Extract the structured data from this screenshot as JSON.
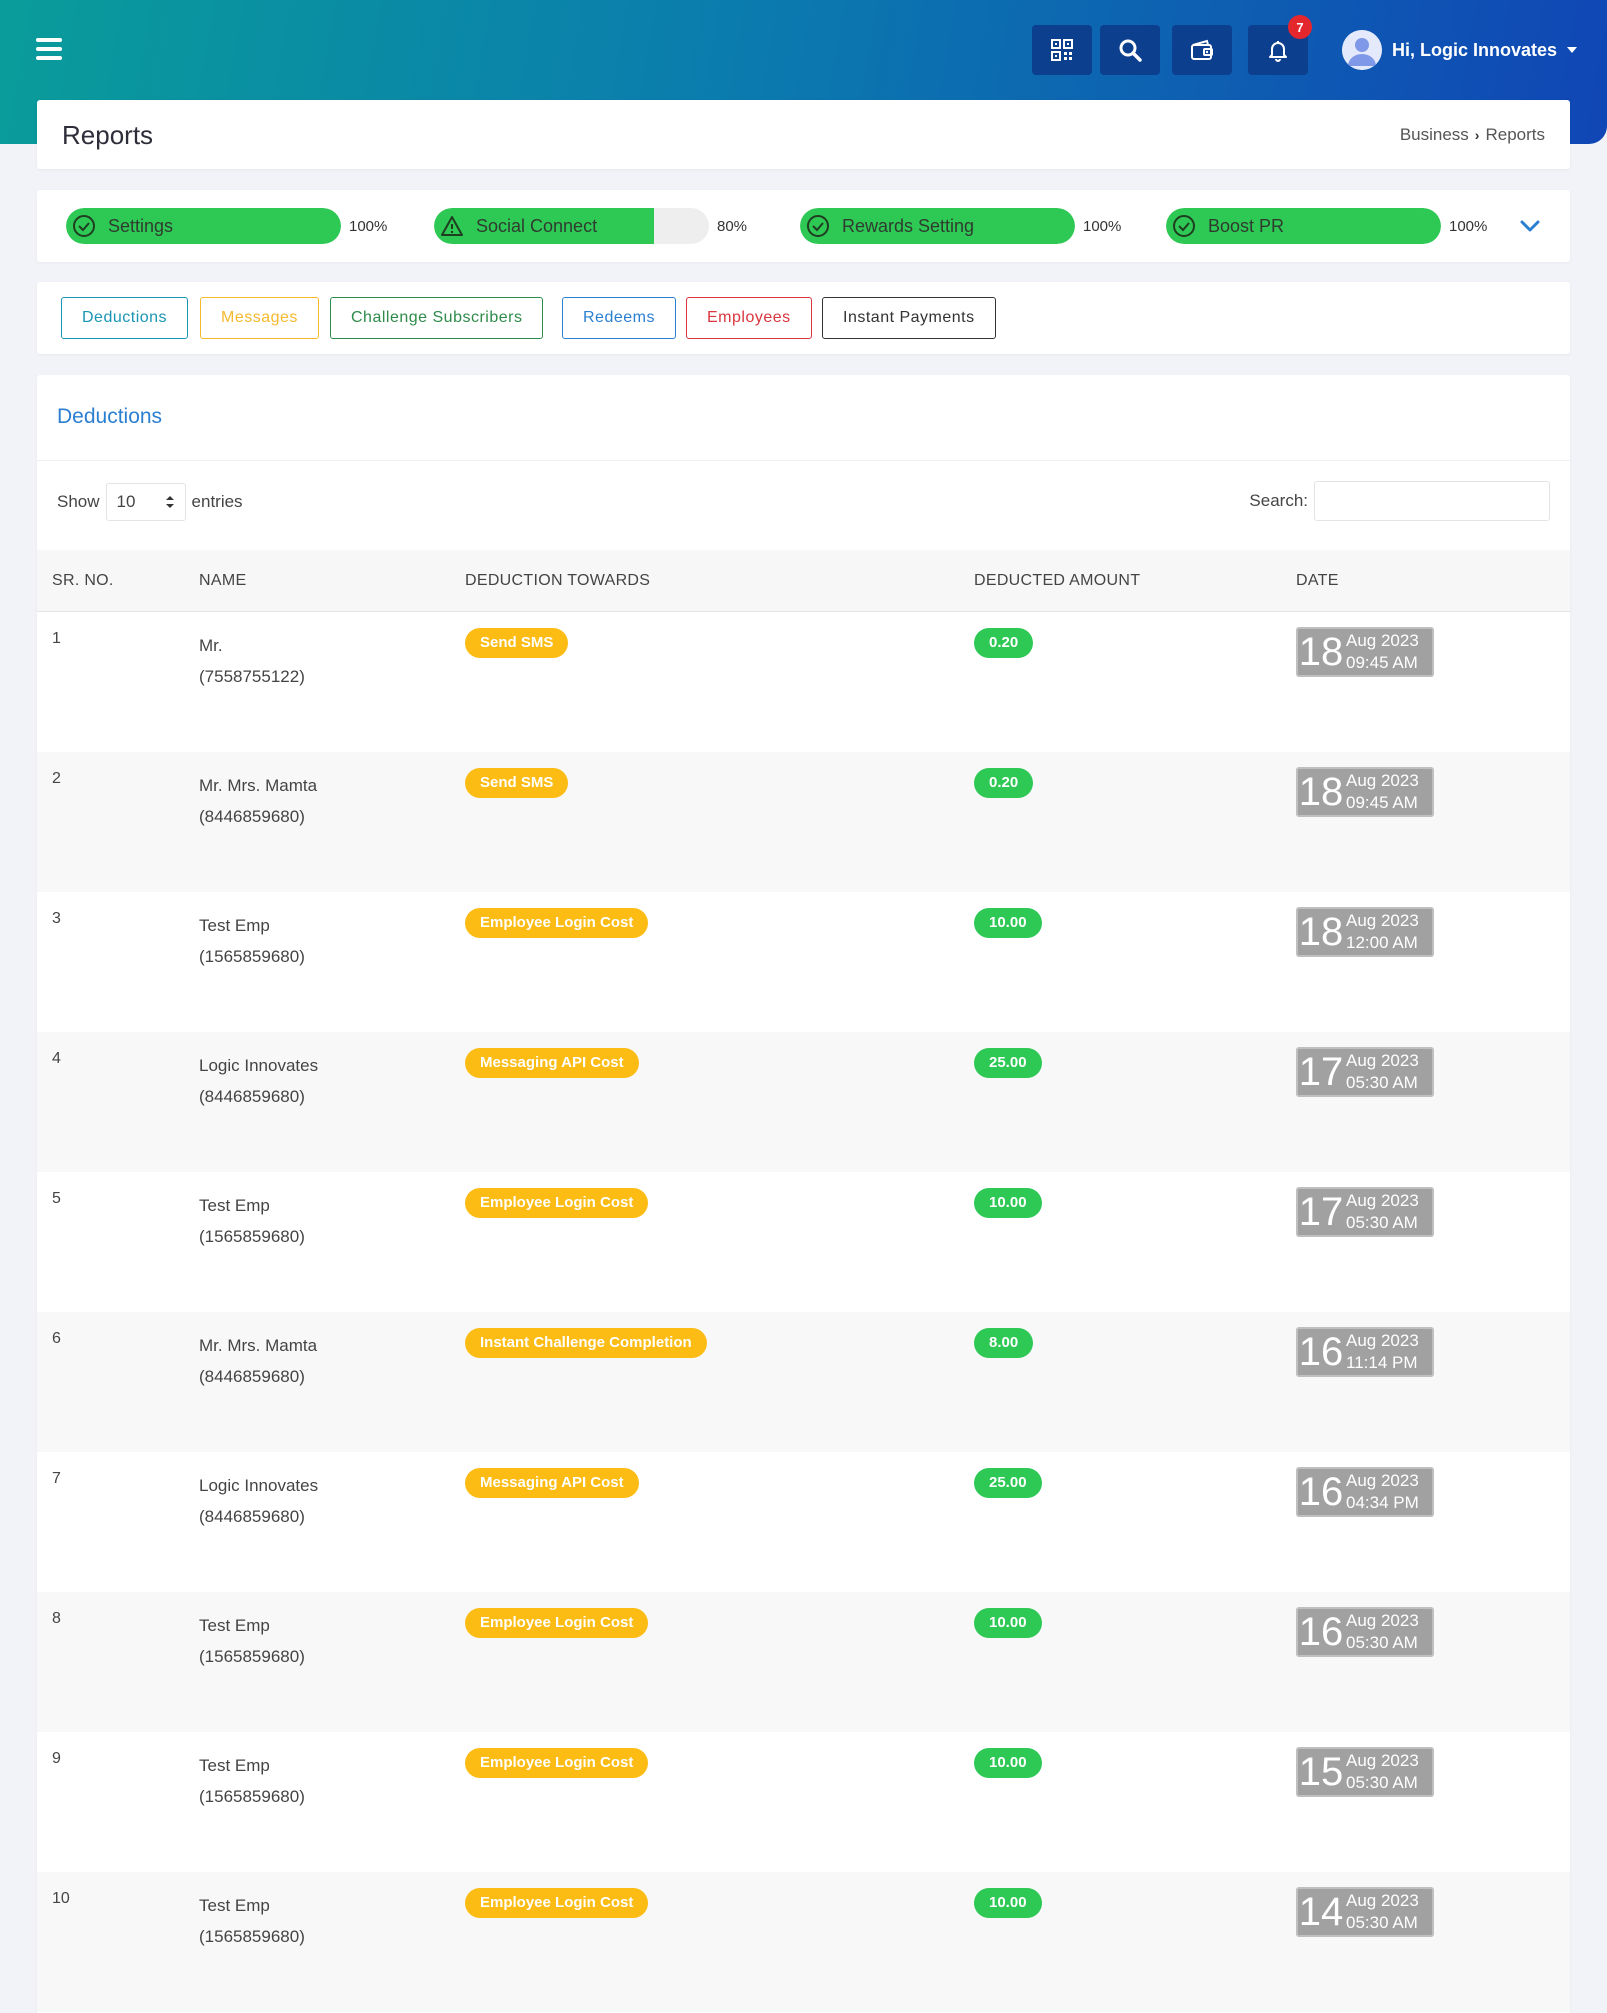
{
  "header": {
    "user_greeting": "Hi, Logic Innovates",
    "notification_count": "7",
    "icons": [
      "menu-icon",
      "qr-code-icon",
      "search-icon",
      "wallet-icon",
      "bell-icon",
      "avatar-icon"
    ]
  },
  "page": {
    "title": "Reports",
    "breadcrumb": {
      "parent": "Business",
      "current": "Reports"
    }
  },
  "progress": [
    {
      "label": "Settings",
      "percent_text": "100%",
      "value": 100,
      "status": "complete"
    },
    {
      "label": "Social Connect",
      "percent_text": "80%",
      "value": 80,
      "status": "warning"
    },
    {
      "label": "Rewards Setting",
      "percent_text": "100%",
      "value": 100,
      "status": "complete"
    },
    {
      "label": "Boost PR",
      "percent_text": "100%",
      "value": 100,
      "status": "complete"
    }
  ],
  "tabs": [
    {
      "label": "Deductions",
      "color": "#1a96b5"
    },
    {
      "label": "Messages",
      "color": "#f6b92e"
    },
    {
      "label": "Challenge Subscribers",
      "color": "#2e8b4a"
    },
    {
      "label": "Redeems",
      "color": "#2b7fd1"
    },
    {
      "label": "Employees",
      "color": "#d9363e"
    },
    {
      "label": "Instant Payments",
      "color": "#333333"
    }
  ],
  "table_section": {
    "title": "Deductions",
    "show_label": "Show",
    "entries_value": "10",
    "entries_label": "entries",
    "search_label": "Search:",
    "search_value": "",
    "columns": [
      "SR. NO.",
      "NAME",
      "DEDUCTION TOWARDS",
      "DEDUCTED AMOUNT",
      "DATE"
    ],
    "rows": [
      {
        "sr": "1",
        "name": "Mr.",
        "phone": "(7558755122)",
        "towards": "Send SMS",
        "amount": "0.20",
        "day": "18",
        "month_year": "Aug 2023",
        "time": "09:45 AM"
      },
      {
        "sr": "2",
        "name": "Mr. Mrs. Mamta",
        "phone": "(8446859680)",
        "towards": "Send SMS",
        "amount": "0.20",
        "day": "18",
        "month_year": "Aug 2023",
        "time": "09:45 AM"
      },
      {
        "sr": "3",
        "name": "Test Emp",
        "phone": "(1565859680)",
        "towards": "Employee Login Cost",
        "amount": "10.00",
        "day": "18",
        "month_year": "Aug 2023",
        "time": "12:00 AM"
      },
      {
        "sr": "4",
        "name": "Logic Innovates",
        "phone": "(8446859680)",
        "towards": "Messaging API Cost",
        "amount": "25.00",
        "day": "17",
        "month_year": "Aug 2023",
        "time": "05:30 AM"
      },
      {
        "sr": "5",
        "name": "Test Emp",
        "phone": "(1565859680)",
        "towards": "Employee Login Cost",
        "amount": "10.00",
        "day": "17",
        "month_year": "Aug 2023",
        "time": "05:30 AM"
      },
      {
        "sr": "6",
        "name": "Mr. Mrs. Mamta",
        "phone": "(8446859680)",
        "towards": "Instant Challenge Completion",
        "amount": "8.00",
        "day": "16",
        "month_year": "Aug 2023",
        "time": "11:14 PM"
      },
      {
        "sr": "7",
        "name": "Logic Innovates",
        "phone": "(8446859680)",
        "towards": "Messaging API Cost",
        "amount": "25.00",
        "day": "16",
        "month_year": "Aug 2023",
        "time": "04:34 PM"
      },
      {
        "sr": "8",
        "name": "Test Emp",
        "phone": "(1565859680)",
        "towards": "Employee Login Cost",
        "amount": "10.00",
        "day": "16",
        "month_year": "Aug 2023",
        "time": "05:30 AM"
      },
      {
        "sr": "9",
        "name": "Test Emp",
        "phone": "(1565859680)",
        "towards": "Employee Login Cost",
        "amount": "10.00",
        "day": "15",
        "month_year": "Aug 2023",
        "time": "05:30 AM"
      },
      {
        "sr": "10",
        "name": "Test Emp",
        "phone": "(1565859680)",
        "towards": "Employee Login Cost",
        "amount": "10.00",
        "day": "14",
        "month_year": "Aug 2023",
        "time": "05:30 AM"
      }
    ]
  }
}
